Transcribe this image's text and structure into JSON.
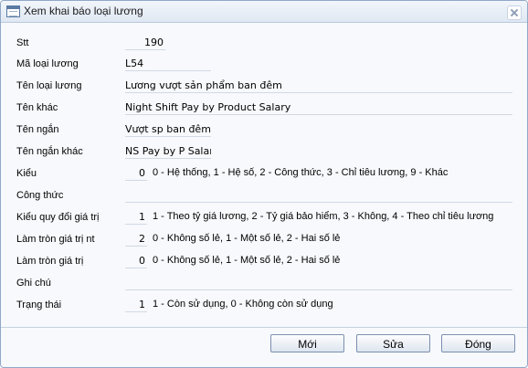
{
  "window": {
    "title": "Xem khai báo loại lương"
  },
  "fields": {
    "stt": {
      "label": "Stt",
      "value": "190"
    },
    "ma_loai_luong": {
      "label": "Mã loại lương",
      "value": "L54"
    },
    "ten_loai_luong": {
      "label": "Tên loại lương",
      "value": "Lương vượt sản phẩm ban đêm"
    },
    "ten_khac": {
      "label": "Tên khác",
      "value": "Night Shift Pay by Product Salary"
    },
    "ten_ngan": {
      "label": "Tên ngắn",
      "value": "Vượt sp ban đêm"
    },
    "ten_ngan_khac": {
      "label": "Tên ngắn khác",
      "value": "NS Pay by P Salary"
    },
    "kieu": {
      "label": "Kiểu",
      "value": "0",
      "hint": "0 - Hệ thống, 1 - Hệ số, 2 - Công thức, 3 - Chỉ tiêu lương, 9 - Khác"
    },
    "cong_thuc": {
      "label": "Công thức",
      "value": ""
    },
    "kieu_quy_doi": {
      "label": "Kiểu quy đổi giá trị",
      "value": "1",
      "hint": "1 - Theo tỷ giá lương, 2 - Tỷ giá bảo hiểm, 3 - Không, 4 - Theo chỉ tiêu lương"
    },
    "lam_tron_nt": {
      "label": "Làm tròn giá trị nt",
      "value": "2",
      "hint": "0 - Không số lẻ, 1 - Một số lẻ, 2 - Hai số lẻ"
    },
    "lam_tron": {
      "label": "Làm tròn giá trị",
      "value": "0",
      "hint": "0 - Không số lẻ, 1 - Một số lẻ, 2 - Hai số lẻ"
    },
    "ghi_chu": {
      "label": "Ghi chú",
      "value": ""
    },
    "trang_thai": {
      "label": "Trạng thái",
      "value": "1",
      "hint": "1 - Còn sử dụng, 0 - Không còn sử dụng"
    }
  },
  "buttons": {
    "new": "Mới",
    "edit": "Sửa",
    "close": "Đóng"
  }
}
